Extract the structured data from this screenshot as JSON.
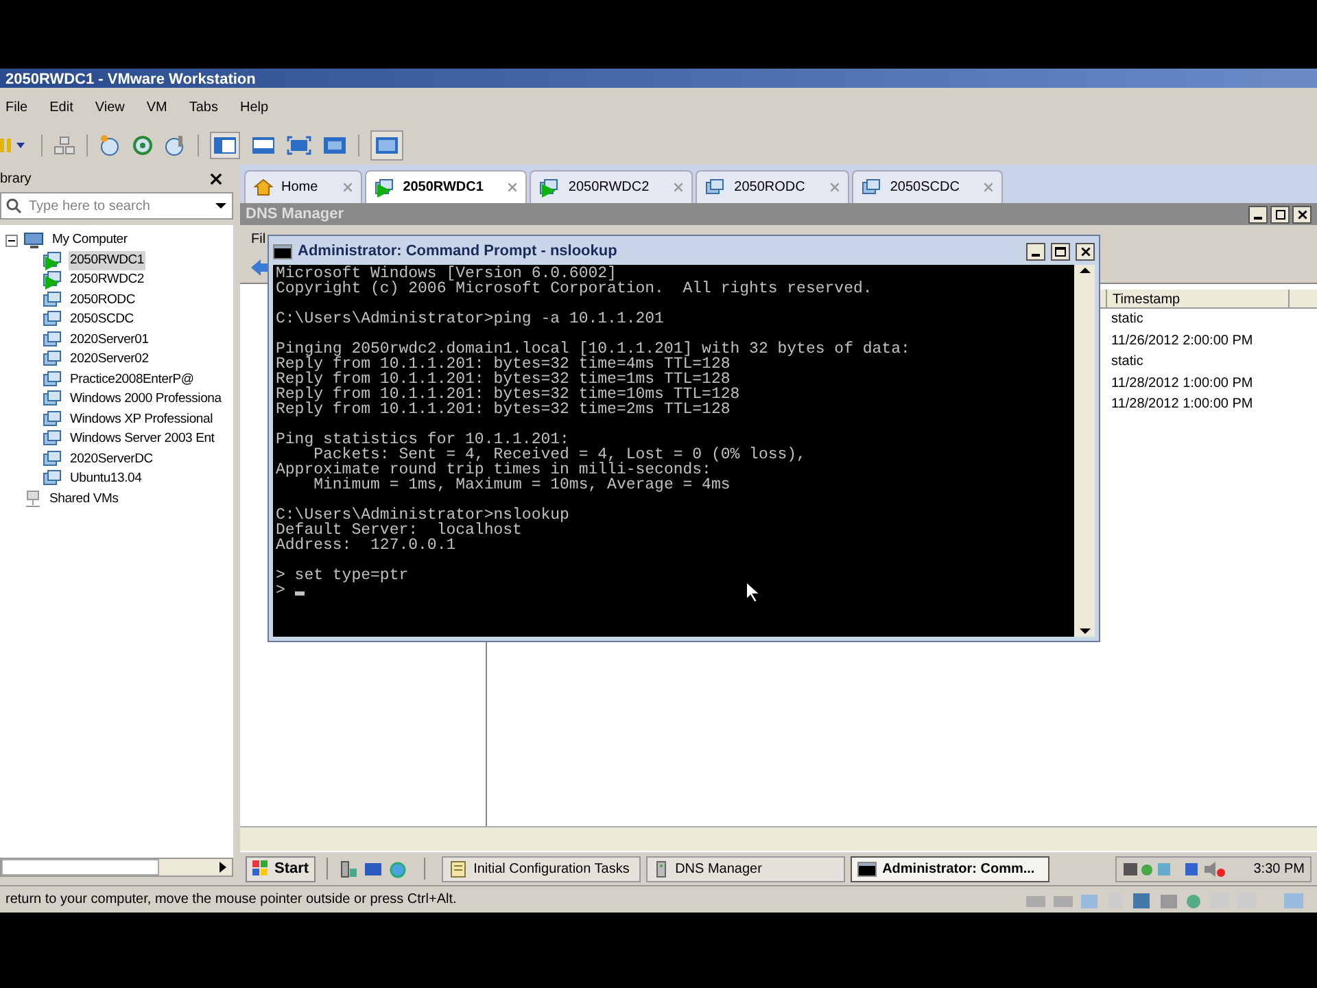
{
  "window": {
    "title": "2050RWDC1 - VMware Workstation"
  },
  "menu": [
    "File",
    "Edit",
    "View",
    "VM",
    "Tabs",
    "Help"
  ],
  "library": {
    "title": "brary",
    "search": {
      "placeholder": "Type here to search"
    },
    "tree": [
      {
        "label": "My Computer",
        "kind": "computer",
        "expanded": true,
        "children": [
          {
            "label": "2050RWDC1",
            "kind": "vm",
            "running": true,
            "selected": true
          },
          {
            "label": "2050RWDC2",
            "kind": "vm",
            "running": true,
            "selected": false
          },
          {
            "label": "2050RODC",
            "kind": "vm",
            "running": false,
            "selected": false
          },
          {
            "label": "2050SCDC",
            "kind": "vm",
            "running": false,
            "selected": false
          },
          {
            "label": "2020Server01",
            "kind": "vm",
            "running": false,
            "selected": false
          },
          {
            "label": "2020Server02",
            "kind": "vm",
            "running": false,
            "selected": false
          },
          {
            "label": "Practice2008EnterP@",
            "kind": "vm",
            "running": false,
            "selected": false
          },
          {
            "label": "Windows 2000 Professiona",
            "kind": "vm",
            "running": false,
            "selected": false
          },
          {
            "label": "Windows XP Professional",
            "kind": "vm",
            "running": false,
            "selected": false
          },
          {
            "label": "Windows Server 2003 Ent",
            "kind": "vm",
            "running": false,
            "selected": false
          },
          {
            "label": "2020ServerDC",
            "kind": "vm",
            "running": false,
            "selected": false
          },
          {
            "label": "Ubuntu13.04",
            "kind": "vm",
            "running": false,
            "selected": false
          }
        ]
      },
      {
        "label": "Shared VMs",
        "kind": "shared",
        "selected": false
      }
    ]
  },
  "tabs": [
    {
      "label": "Home",
      "kind": "home",
      "selected": false
    },
    {
      "label": "2050RWDC1",
      "kind": "vm",
      "running": true,
      "selected": true
    },
    {
      "label": "2050RWDC2",
      "kind": "vm",
      "running": true,
      "selected": false
    },
    {
      "label": "2050RODC",
      "kind": "vm",
      "running": false,
      "selected": false
    },
    {
      "label": "2050SCDC",
      "kind": "vm",
      "running": false,
      "selected": false
    }
  ],
  "dns_manager": {
    "title": "DNS Manager",
    "menu": [
      "Fil"
    ],
    "column": "Timestamp",
    "rows": [
      "static",
      "11/26/2012 2:00:00 PM",
      "static",
      "11/28/2012 1:00:00 PM",
      "11/28/2012 1:00:00 PM"
    ]
  },
  "command_prompt": {
    "title": "Administrator: Command Prompt - nslookup",
    "blocks": [
      [
        "Microsoft Windows [Version 6.0.6002]",
        "Copyright (c) 2006 Microsoft Corporation.  All rights reserved."
      ],
      [
        "C:\\Users\\Administrator>ping -a 10.1.1.201"
      ],
      [
        "Pinging 2050rwdc2.domain1.local [10.1.1.201] with 32 bytes of data:",
        "Reply from 10.1.1.201: bytes=32 time=4ms TTL=128",
        "Reply from 10.1.1.201: bytes=32 time=1ms TTL=128",
        "Reply from 10.1.1.201: bytes=32 time=10ms TTL=128",
        "Reply from 10.1.1.201: bytes=32 time=2ms TTL=128"
      ],
      [
        "Ping statistics for 10.1.1.201:",
        "    Packets: Sent = 4, Received = 4, Lost = 0 (0% loss),",
        "Approximate round trip times in milli-seconds:",
        "    Minimum = 1ms, Maximum = 10ms, Average = 4ms"
      ],
      [
        "C:\\Users\\Administrator>nslookup",
        "Default Server:  localhost",
        "Address:  127.0.0.1"
      ],
      [
        "> set type=ptr",
        "> "
      ]
    ]
  },
  "taskbar": {
    "start": "Start",
    "items": [
      {
        "label": "Initial Configuration Tasks",
        "kind": "tasks",
        "selected": false
      },
      {
        "label": "DNS Manager",
        "kind": "dns",
        "selected": false
      },
      {
        "label": "Administrator: Comm...",
        "kind": "cmd",
        "selected": true
      }
    ],
    "clock": "3:30 PM"
  },
  "status_bar": "return to your computer, move the mouse pointer outside or press Ctrl+Alt."
}
